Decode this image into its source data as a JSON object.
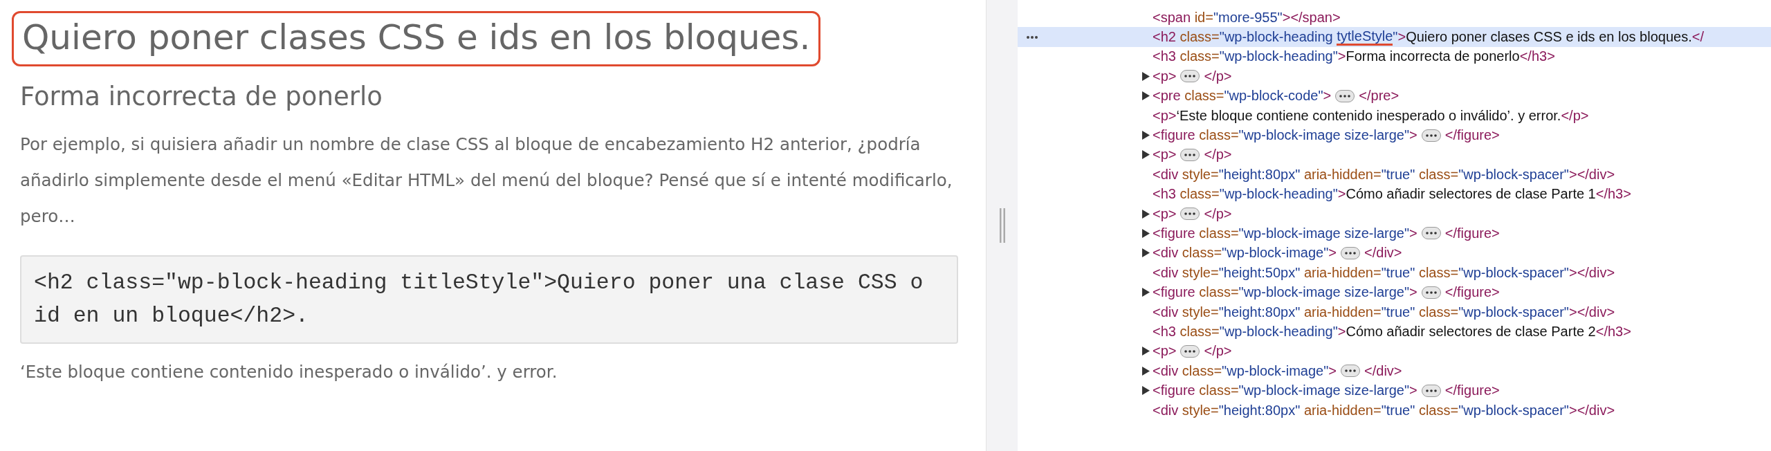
{
  "article": {
    "title": {
      "text": "Quiero poner clases CSS e ids en los bloques.",
      "outlined": true
    },
    "subtitle": "Forma incorrecta de ponerlo",
    "paragraph": "Por ejemplo, si quisiera añadir un nombre de clase CSS al bloque de encabezamiento H2 anterior, ¿podría añadirlo simplemente desde el menú «Editar HTML» del menú del bloque? Pensé que sí e intenté modificarlo, pero…",
    "code": "<h2 class=\"wp-block-heading titleStyle\">Quiero poner una clase CSS o id en un bloque</h2>.",
    "note": "‘Este bloque contiene contenido inesperado o inválido’. y error."
  },
  "devtools": {
    "rows": [
      {
        "collapsed": false,
        "selected": false,
        "parts": [
          {
            "kind": "tag",
            "text": "<span"
          },
          {
            "kind": "attr",
            "text": "id="
          },
          {
            "kind": "value",
            "text": "\"more-955\""
          },
          {
            "kind": "tag",
            "text": "></span>"
          }
        ]
      },
      {
        "collapsed": false,
        "selected": true,
        "parts": [
          {
            "kind": "tag",
            "text": "<h2"
          },
          {
            "kind": "attr",
            "text": "class="
          },
          {
            "kind": "value",
            "text": "\"wp-block-heading "
          },
          {
            "kind": "value",
            "text": "tytleStyle",
            "underlined": true
          },
          {
            "kind": "value",
            "text": "\""
          },
          {
            "kind": "tag",
            "text": ">"
          },
          {
            "kind": "text",
            "text": "Quiero poner clases CSS e ids en los bloques."
          },
          {
            "kind": "tag",
            "text": "</"
          }
        ]
      },
      {
        "collapsed": false,
        "selected": false,
        "parts": [
          {
            "kind": "tag",
            "text": "<h3"
          },
          {
            "kind": "attr",
            "text": "class="
          },
          {
            "kind": "value",
            "text": "\"wp-block-heading\""
          },
          {
            "kind": "tag",
            "text": ">"
          },
          {
            "kind": "text",
            "text": "Forma incorrecta de ponerlo"
          },
          {
            "kind": "tag",
            "text": "</h3>"
          }
        ]
      },
      {
        "collapsed": true,
        "selected": false,
        "parts": [
          {
            "kind": "tag",
            "text": "<p>"
          },
          {
            "kind": "ellipsis"
          },
          {
            "kind": "tag",
            "text": "</p>"
          }
        ]
      },
      {
        "collapsed": true,
        "selected": false,
        "parts": [
          {
            "kind": "tag",
            "text": "<pre"
          },
          {
            "kind": "attr",
            "text": "class="
          },
          {
            "kind": "value",
            "text": "\"wp-block-code\""
          },
          {
            "kind": "tag",
            "text": ">"
          },
          {
            "kind": "ellipsis"
          },
          {
            "kind": "tag",
            "text": "</pre>"
          }
        ]
      },
      {
        "collapsed": false,
        "selected": false,
        "parts": [
          {
            "kind": "tag",
            "text": "<p>"
          },
          {
            "kind": "text",
            "text": "‘Este bloque contiene contenido inesperado o inválido’. y error."
          },
          {
            "kind": "tag",
            "text": "</p>"
          }
        ]
      },
      {
        "collapsed": true,
        "selected": false,
        "parts": [
          {
            "kind": "tag",
            "text": "<figure"
          },
          {
            "kind": "attr",
            "text": "class="
          },
          {
            "kind": "value",
            "text": "\"wp-block-image size-large\""
          },
          {
            "kind": "tag",
            "text": ">"
          },
          {
            "kind": "ellipsis"
          },
          {
            "kind": "tag",
            "text": "</figure>"
          }
        ]
      },
      {
        "collapsed": true,
        "selected": false,
        "parts": [
          {
            "kind": "tag",
            "text": "<p>"
          },
          {
            "kind": "ellipsis"
          },
          {
            "kind": "tag",
            "text": "</p>"
          }
        ]
      },
      {
        "collapsed": false,
        "selected": false,
        "parts": [
          {
            "kind": "tag",
            "text": "<div"
          },
          {
            "kind": "attr",
            "text": "style="
          },
          {
            "kind": "value",
            "text": "\"height:80px\""
          },
          {
            "kind": "attr",
            "text": "aria-hidden="
          },
          {
            "kind": "value",
            "text": "\"true\""
          },
          {
            "kind": "attr",
            "text": "class="
          },
          {
            "kind": "value",
            "text": "\"wp-block-spacer\""
          },
          {
            "kind": "tag",
            "text": "></div>"
          }
        ]
      },
      {
        "collapsed": false,
        "selected": false,
        "parts": [
          {
            "kind": "tag",
            "text": "<h3"
          },
          {
            "kind": "attr",
            "text": "class="
          },
          {
            "kind": "value",
            "text": "\"wp-block-heading\""
          },
          {
            "kind": "tag",
            "text": ">"
          },
          {
            "kind": "text",
            "text": "Cómo añadir selectores de clase Parte 1"
          },
          {
            "kind": "tag",
            "text": "</h3>"
          }
        ]
      },
      {
        "collapsed": true,
        "selected": false,
        "parts": [
          {
            "kind": "tag",
            "text": "<p>"
          },
          {
            "kind": "ellipsis"
          },
          {
            "kind": "tag",
            "text": "</p>"
          }
        ]
      },
      {
        "collapsed": true,
        "selected": false,
        "parts": [
          {
            "kind": "tag",
            "text": "<figure"
          },
          {
            "kind": "attr",
            "text": "class="
          },
          {
            "kind": "value",
            "text": "\"wp-block-image size-large\""
          },
          {
            "kind": "tag",
            "text": ">"
          },
          {
            "kind": "ellipsis"
          },
          {
            "kind": "tag",
            "text": "</figure>"
          }
        ]
      },
      {
        "collapsed": true,
        "selected": false,
        "parts": [
          {
            "kind": "tag",
            "text": "<div"
          },
          {
            "kind": "attr",
            "text": "class="
          },
          {
            "kind": "value",
            "text": "\"wp-block-image\""
          },
          {
            "kind": "tag",
            "text": ">"
          },
          {
            "kind": "ellipsis"
          },
          {
            "kind": "tag",
            "text": "</div>"
          }
        ]
      },
      {
        "collapsed": false,
        "selected": false,
        "parts": [
          {
            "kind": "tag",
            "text": "<div"
          },
          {
            "kind": "attr",
            "text": "style="
          },
          {
            "kind": "value",
            "text": "\"height:50px\""
          },
          {
            "kind": "attr",
            "text": "aria-hidden="
          },
          {
            "kind": "value",
            "text": "\"true\""
          },
          {
            "kind": "attr",
            "text": "class="
          },
          {
            "kind": "value",
            "text": "\"wp-block-spacer\""
          },
          {
            "kind": "tag",
            "text": "></div>"
          }
        ]
      },
      {
        "collapsed": true,
        "selected": false,
        "parts": [
          {
            "kind": "tag",
            "text": "<figure"
          },
          {
            "kind": "attr",
            "text": "class="
          },
          {
            "kind": "value",
            "text": "\"wp-block-image size-large\""
          },
          {
            "kind": "tag",
            "text": ">"
          },
          {
            "kind": "ellipsis"
          },
          {
            "kind": "tag",
            "text": "</figure>"
          }
        ]
      },
      {
        "collapsed": false,
        "selected": false,
        "parts": [
          {
            "kind": "tag",
            "text": "<div"
          },
          {
            "kind": "attr",
            "text": "style="
          },
          {
            "kind": "value",
            "text": "\"height:80px\""
          },
          {
            "kind": "attr",
            "text": "aria-hidden="
          },
          {
            "kind": "value",
            "text": "\"true\""
          },
          {
            "kind": "attr",
            "text": "class="
          },
          {
            "kind": "value",
            "text": "\"wp-block-spacer\""
          },
          {
            "kind": "tag",
            "text": "></div>"
          }
        ]
      },
      {
        "collapsed": false,
        "selected": false,
        "parts": [
          {
            "kind": "tag",
            "text": "<h3"
          },
          {
            "kind": "attr",
            "text": "class="
          },
          {
            "kind": "value",
            "text": "\"wp-block-heading\""
          },
          {
            "kind": "tag",
            "text": ">"
          },
          {
            "kind": "text",
            "text": "Cómo añadir selectores de clase Parte 2"
          },
          {
            "kind": "tag",
            "text": "</h3>"
          }
        ]
      },
      {
        "collapsed": true,
        "selected": false,
        "parts": [
          {
            "kind": "tag",
            "text": "<p>"
          },
          {
            "kind": "ellipsis"
          },
          {
            "kind": "tag",
            "text": "</p>"
          }
        ]
      },
      {
        "collapsed": true,
        "selected": false,
        "parts": [
          {
            "kind": "tag",
            "text": "<div"
          },
          {
            "kind": "attr",
            "text": "class="
          },
          {
            "kind": "value",
            "text": "\"wp-block-image\""
          },
          {
            "kind": "tag",
            "text": ">"
          },
          {
            "kind": "ellipsis"
          },
          {
            "kind": "tag",
            "text": "</div>"
          }
        ]
      },
      {
        "collapsed": true,
        "selected": false,
        "parts": [
          {
            "kind": "tag",
            "text": "<figure"
          },
          {
            "kind": "attr",
            "text": "class="
          },
          {
            "kind": "value",
            "text": "\"wp-block-image size-large\""
          },
          {
            "kind": "tag",
            "text": ">"
          },
          {
            "kind": "ellipsis"
          },
          {
            "kind": "tag",
            "text": "</figure>"
          }
        ]
      },
      {
        "collapsed": false,
        "selected": false,
        "parts": [
          {
            "kind": "tag",
            "text": "<div"
          },
          {
            "kind": "attr",
            "text": "style="
          },
          {
            "kind": "value",
            "text": "\"height:80px\""
          },
          {
            "kind": "attr",
            "text": "aria-hidden="
          },
          {
            "kind": "value",
            "text": "\"true\""
          },
          {
            "kind": "attr",
            "text": "class="
          },
          {
            "kind": "value",
            "text": "\"wp-block-spacer\""
          },
          {
            "kind": "tag",
            "text": "></div>"
          }
        ]
      }
    ]
  }
}
